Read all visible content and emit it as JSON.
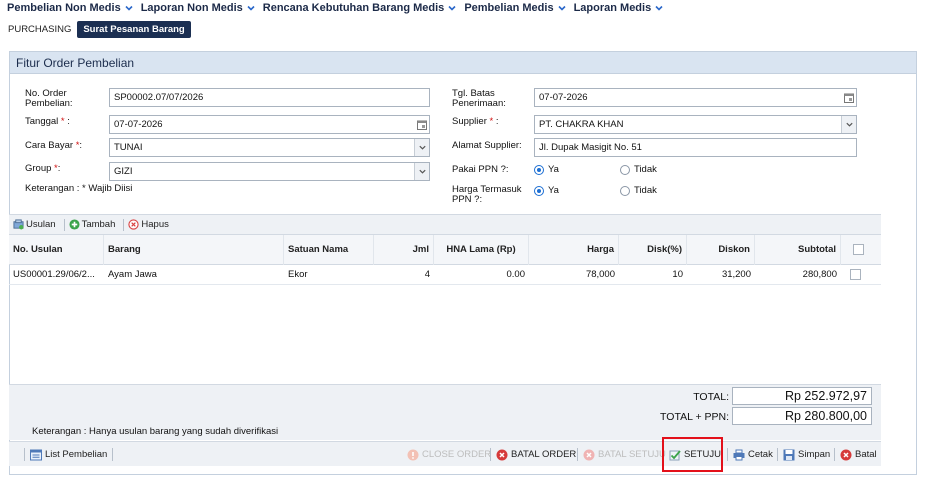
{
  "topnav": {
    "menus": [
      "Pembelian Non Medis",
      "Laporan Non Medis",
      "Rencana Kebutuhan Barang Medis",
      "Pembelian Medis",
      "Laporan Medis"
    ]
  },
  "subtabs": {
    "crumb": "PURCHASING",
    "active_tab": "Surat Pesanan Barang"
  },
  "panel": {
    "title": "Fitur Order Pembelian"
  },
  "form": {
    "no_order_label": "No. Order Pembelian:",
    "no_order_value": "SP00002.07/07/2026",
    "tanggal_label": "Tanggal",
    "tanggal_value": "07-07-2026",
    "cara_bayar_label": "Cara Bayar",
    "cara_bayar_value": "TUNAI",
    "group_label": "Group",
    "group_value": "GIZI",
    "keterangan_label": "Keterangan :",
    "wajib_note": "* Wajib Diisi",
    "tgl_batas_label": "Tgl. Batas Penerimaan:",
    "tgl_batas_value": "07-07-2026",
    "supplier_label": "Supplier",
    "supplier_value": "PT. CHAKRA KHAN",
    "alamat_label": "Alamat Supplier:",
    "alamat_value": "Jl. Dupak Masigit No. 51",
    "ppn_label": "Pakai PPN ?:",
    "harga_ppn_label": "Harga Termasuk PPN ?:",
    "ya": "Ya",
    "tidak": "Tidak",
    "req_mark": "*",
    "colon": ":"
  },
  "grid_toolbar": {
    "usulan": "Usulan",
    "tambah": "Tambah",
    "hapus": "Hapus"
  },
  "grid": {
    "columns": [
      "No. Usulan",
      "Barang",
      "Satuan Nama",
      "Jml",
      "HNA Lama (Rp)",
      "Harga",
      "Disk(%)",
      "Diskon",
      "Subtotal"
    ],
    "rows": [
      {
        "no_usulan": "US00001.29/06/2...",
        "barang": "Ayam Jawa",
        "satuan": "Ekor",
        "jml": "4",
        "hna_lama": "0.00",
        "harga": "78,000",
        "disk": "10",
        "diskon": "31,200",
        "subtotal": "280,800"
      }
    ]
  },
  "totals": {
    "total_label": "TOTAL:",
    "total_value": "Rp 252.972,97",
    "total_ppn_label": "TOTAL + PPN:",
    "total_ppn_value": "Rp 280.800,00"
  },
  "note": "Keterangan : Hanya usulan barang yang sudah diverifikasi",
  "bottombar": {
    "list_pembelian": "List Pembelian",
    "close_order": "CLOSE ORDER",
    "batal_order": "BATAL ORDER",
    "batal_setuju": "BATAL SETUJU",
    "setuju": "SETUJU",
    "cetak": "Cetak",
    "simpan": "Simpan",
    "batal": "Batal"
  },
  "colors": {
    "accent": "#1b2f52",
    "panel_header": "#d9e4f1",
    "highlight": "#e3101a",
    "radio_on": "#1d6fd3"
  }
}
